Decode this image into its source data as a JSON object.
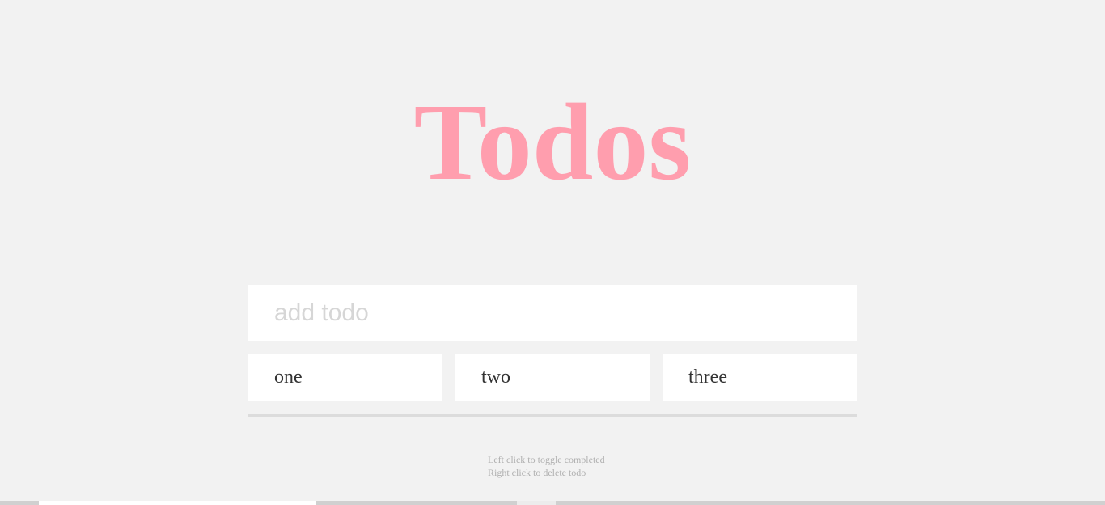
{
  "app": {
    "title": "Todos"
  },
  "add_todo": {
    "placeholder": "add todo",
    "value": ""
  },
  "todos": [
    {
      "label": "one"
    },
    {
      "label": "two"
    },
    {
      "label": "three"
    }
  ],
  "help": {
    "line1": "Left click to toggle completed",
    "line2": "Right click to delete todo"
  },
  "colors": {
    "background": "#f2f2f2",
    "title": "#ff9eae",
    "card": "#ffffff",
    "divider": "#dcdcdc",
    "help_text": "#b0b0b0"
  }
}
